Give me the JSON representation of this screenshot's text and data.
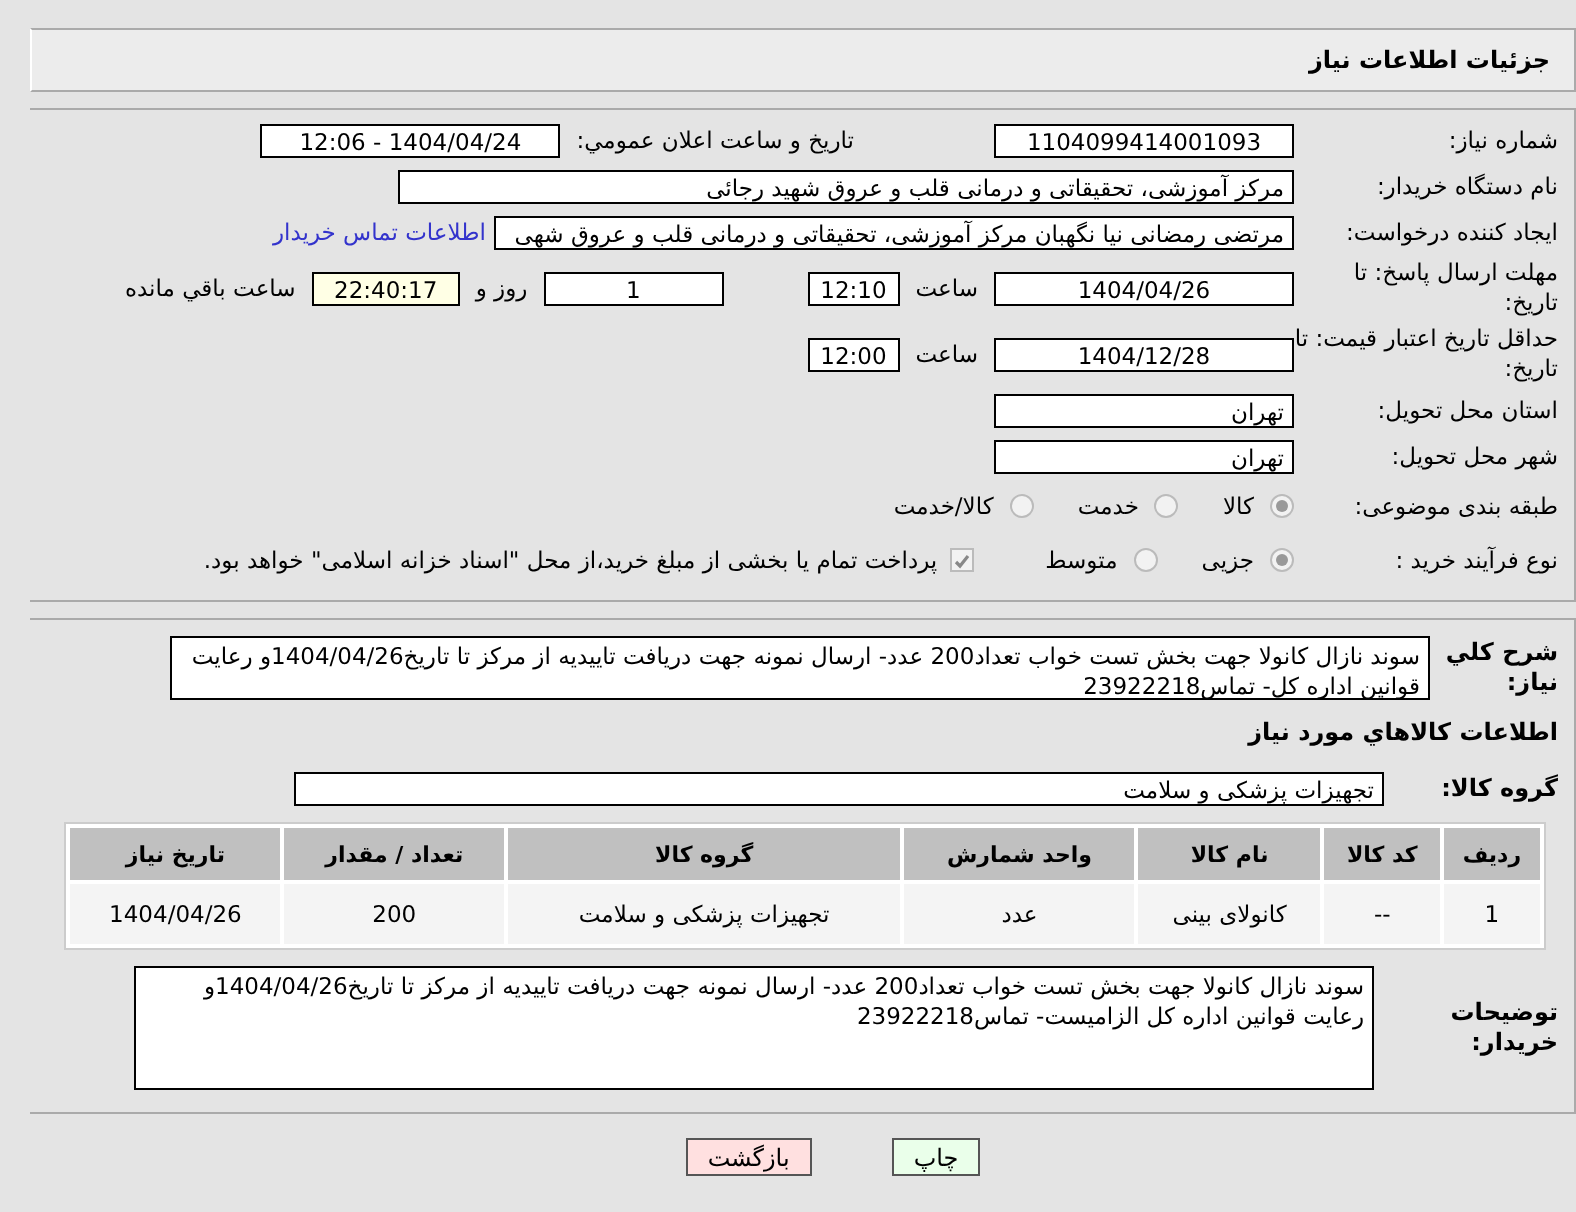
{
  "header": {
    "title": "جزئیات اطلاعات نیاز"
  },
  "need_number": {
    "label": "شماره نیاز:",
    "value": "1104099414001093"
  },
  "announce": {
    "label": "تاريخ و ساعت اعلان عمومي:",
    "value": "1404/04/24 - 12:06"
  },
  "buyer": {
    "label": "نام دستگاه خریدار:",
    "value": "مرکز آموزشی، تحقیقاتی و درمانی قلب و عروق شهید رجائی"
  },
  "creator": {
    "label": "ایجاد کننده درخواست:",
    "value": "مرتضی رمضانی نیا نگهبان مرکز آموزشی، تحقیقاتی و درمانی قلب و عروق شهی",
    "link": "اطلاعات تماس خریدار"
  },
  "deadline": {
    "label": "مهلت ارسال پاسخ: تا تاریخ:",
    "date": "1404/04/26",
    "time_label": "ساعت",
    "time": "12:10",
    "days": "1",
    "days_label": "روز و",
    "remaining": "22:40:17",
    "remaining_label": "ساعت باقي مانده"
  },
  "validity": {
    "label": "حداقل تاریخ اعتبار قیمت: تا تاریخ:",
    "date": "1404/12/28",
    "time_label": "ساعت",
    "time": "12:00"
  },
  "province": {
    "label": "استان محل تحویل:",
    "value": "تهران"
  },
  "city": {
    "label": "شهر محل تحویل:",
    "value": "تهران"
  },
  "category": {
    "label": "طبقه بندی موضوعی:",
    "options": [
      {
        "label": "کالا",
        "selected": true
      },
      {
        "label": "خدمت",
        "selected": false
      },
      {
        "label": "کالا/خدمت",
        "selected": false
      }
    ]
  },
  "process": {
    "label": "نوع فرآیند خرید :",
    "options": [
      {
        "label": "جزیی",
        "selected": true
      },
      {
        "label": "متوسط",
        "selected": false
      }
    ],
    "payment": {
      "checked": true,
      "text": "پرداخت تمام یا بخشی از مبلغ خرید،از محل \"اسناد خزانه اسلامی\" خواهد بود."
    }
  },
  "summary": {
    "label": "شرح کلي نياز:",
    "value": "سوند نازال کانولا جهت بخش تست خواب تعداد200 عدد- ارسال نمونه جهت دریافت تاییدیه از مرکز تا تاریخ1404/04/26و رعایت قوانین اداره کل- تماس23922218"
  },
  "goods_title": "اطلاعات کالاهاي مورد نياز",
  "goods_group": {
    "label": "گروه کالا:",
    "value": "تجهیزات پزشکی و سلامت"
  },
  "table": {
    "columns": [
      "ردیف",
      "کد کالا",
      "نام کالا",
      "واحد شمارش",
      "گروه کالا",
      "تعداد / مقدار",
      "تاریخ نیاز"
    ],
    "rows": [
      [
        "1",
        "--",
        "کانولای بینی",
        "عدد",
        "تجهیزات پزشکی و سلامت",
        "200",
        "1404/04/26"
      ]
    ]
  },
  "buyer_notes": {
    "label": "توضیحات خریدار:",
    "value": "سوند نازال کانولا جهت بخش تست خواب تعداد200 عدد- ارسال نمونه جهت دریافت تاییدیه از مرکز تا تاریخ1404/04/26و رعایت قوانین اداره کل الزامیست- تماس23922218"
  },
  "buttons": [
    {
      "label": "چاپ",
      "kind": "print"
    },
    {
      "label": "بازگشت",
      "kind": "back"
    }
  ]
}
